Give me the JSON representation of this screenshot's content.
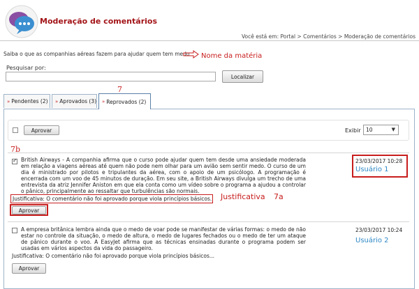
{
  "header": {
    "title": "Moderação de comentários",
    "breadcrumb": "Você está em: Portal > Comentários > Moderação de comentários"
  },
  "topic": {
    "text": "Saiba o que as companhias aéreas fazem para ajudar quem tem medo"
  },
  "search": {
    "label": "Pesquisar por:",
    "value": "",
    "button": "Localizar"
  },
  "tabs": [
    {
      "label": "Pendentes (2)"
    },
    {
      "label": "Aprovados (3)"
    },
    {
      "label": "Reprovados (2)",
      "active": true
    }
  ],
  "toolbar": {
    "approve_label": "Aprovar",
    "exibir_label": "Exibir",
    "exibir_value": "10"
  },
  "comments": [
    {
      "checked": true,
      "text": "British Airways - A companhia afirma que o curso pode ajudar quem tem desde uma ansiedade moderada em relação a viagens aéreas até quem não pode nem olhar para um avião sem sentir medo. O curso de um dia é ministrado por pilotos e tripulantes da aérea, com o apoio de um psicólogo. A programação é encerrada com um voo de 45 minutos de duração. Em seu site, a British Airways divulga um trecho de uma entrevista da atriz Jennifer Aniston em que ela conta como um vídeo sobre o programa a ajudou a controlar o pânico, principalmente ao ressaltar que turbulências são normais.",
      "justification": "Justificativa: O comentário não foi aprovado porque viola princípios básicos...",
      "date": "23/03/2017 10:28",
      "user": "Usuário 1",
      "approve_label": "Aprovar"
    },
    {
      "checked": false,
      "text": "A empresa britânica lembra ainda que o medo de voar pode se manifestar de várias formas: o medo de não estar no controle da situação, o medo de altura, o medo de lugares fechados ou o medo de ter um ataque de pânico durante o voo. A EasyJet afirma que as técnicas ensinadas durante o programa podem ser usadas em vários aspectos da vida do passageiro.",
      "justification": "Justificativa: O comentário não foi aprovado porque viola princípios básicos...",
      "date": "23/03/2017 10:24",
      "user": "Usuário 2",
      "approve_label": "Aprovar"
    }
  ],
  "annotations": {
    "nome_materia": "Nome da matéria",
    "step_7": "7",
    "step_7b": "7b",
    "justificativa": "Justificativa",
    "step_7a": "7a"
  },
  "colors": {
    "title_red": "#a31418",
    "annotation_red": "#c81d1d",
    "user_blue": "#2e88c6",
    "tab_border": "#9db3c9"
  },
  "icons": {
    "logo": "speech-bubbles-icon",
    "tab_marker": "double-chevron-down-icon",
    "annotation_arrow": "arrow-right-icon"
  }
}
